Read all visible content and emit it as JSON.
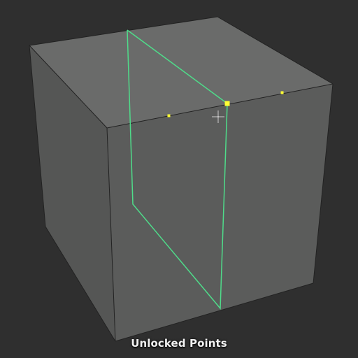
{
  "viewport": {
    "background": "#2f2f2f",
    "caption": "Unlocked Points"
  },
  "mesh": {
    "object": "cube",
    "face_colors": {
      "top": "#6a6b6a",
      "left": "#555655",
      "front": "#5b5c5b"
    },
    "edge_color": "#222222",
    "highlight_color": "#4fdc8a",
    "point_color": "#ffff33"
  },
  "cursor": {
    "icon": "crosshair-cursor-icon",
    "color": "#ffffff"
  }
}
